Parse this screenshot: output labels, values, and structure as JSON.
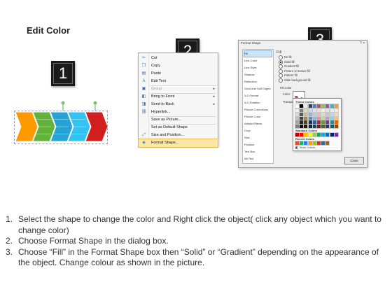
{
  "title": "Edit Color",
  "steps": {
    "one": "1",
    "two": "2",
    "three": "3"
  },
  "context_menu": {
    "items": [
      {
        "label": "Cut",
        "icon": "scissors-icon",
        "enabled": true,
        "submenu": false
      },
      {
        "label": "Copy",
        "icon": "copy-icon",
        "enabled": true,
        "submenu": false
      },
      {
        "label": "Paste",
        "icon": "paste-icon",
        "enabled": true,
        "submenu": false
      },
      {
        "label": "Edit Text",
        "icon": "edit-text-icon",
        "enabled": true,
        "submenu": false
      },
      {
        "label": "Group",
        "icon": "group-icon",
        "enabled": false,
        "submenu": true
      },
      {
        "label": "Bring to Front",
        "icon": "bring-front-icon",
        "enabled": true,
        "submenu": true
      },
      {
        "label": "Send to Back",
        "icon": "send-back-icon",
        "enabled": true,
        "submenu": true
      },
      {
        "label": "Hyperlink...",
        "icon": "hyperlink-icon",
        "enabled": true,
        "submenu": false
      },
      {
        "label": "Save as Picture...",
        "icon": "",
        "enabled": true,
        "submenu": false
      },
      {
        "label": "Set as Default Shape",
        "icon": "",
        "enabled": true,
        "submenu": false
      },
      {
        "label": "Size and Position...",
        "icon": "size-position-icon",
        "enabled": true,
        "submenu": false
      },
      {
        "label": "Format Shape...",
        "icon": "format-shape-icon",
        "enabled": true,
        "submenu": false,
        "highlighted": true
      }
    ]
  },
  "format_dialog": {
    "title": "Format Shape",
    "window_controls": "? ×",
    "categories": [
      "Fill",
      "Line Color",
      "Line Style",
      "Shadow",
      "Reflection",
      "Glow and Soft Edges",
      "3-D Format",
      "3-D Rotation",
      "Picture Corrections",
      "Picture Color",
      "Artistic Effects",
      "Crop",
      "Size",
      "Position",
      "Text Box",
      "Alt Text"
    ],
    "selected_category": "Fill",
    "heading": "Fill",
    "fill_options": [
      "No fill",
      "Solid fill",
      "Gradient fill",
      "Picture or texture fill",
      "Pattern fill",
      "Slide background fill"
    ],
    "selected_fill": "Solid fill",
    "fill_color_label": "Fill Color",
    "color_label": "Color:",
    "transparency_label": "Transpar",
    "close_label": "Close"
  },
  "palette": {
    "theme_label": "Theme Colors",
    "standard_label": "Standard Colors",
    "recent_label": "Recent Colors",
    "more_label": "More Colors...",
    "theme_top": [
      "#ffffff",
      "#000000",
      "#eeece1",
      "#1f497d",
      "#4f81bd",
      "#c0504d",
      "#9bbb59",
      "#8064a2",
      "#4bacc6",
      "#f79646"
    ],
    "theme_columns": [
      [
        "#f2f2f2",
        "#d9d9d9",
        "#bfbfbf",
        "#a6a6a6",
        "#808080"
      ],
      [
        "#7f7f7f",
        "#595959",
        "#404040",
        "#262626",
        "#0d0d0d"
      ],
      [
        "#ddd9c3",
        "#c4bd97",
        "#948a54",
        "#4a452a",
        "#1d1b10"
      ],
      [
        "#c6d9f1",
        "#8db3e2",
        "#548dd4",
        "#17365d",
        "#0f243e"
      ],
      [
        "#dbe5f1",
        "#b8cce4",
        "#95b3d7",
        "#366092",
        "#244061"
      ],
      [
        "#f2dcdb",
        "#e6b9b8",
        "#d99694",
        "#953734",
        "#632423"
      ],
      [
        "#ebf1dd",
        "#d7e3bc",
        "#c3d69b",
        "#76923c",
        "#4f6128"
      ],
      [
        "#e5e0ec",
        "#ccc1d9",
        "#b2a2c7",
        "#5f497a",
        "#3f3151"
      ],
      [
        "#dbeef3",
        "#b7dde8",
        "#92cddc",
        "#31859b",
        "#205867"
      ],
      [
        "#fdeada",
        "#fbd5b5",
        "#fac08f",
        "#e36c09",
        "#974806"
      ]
    ],
    "standard": [
      "#c00000",
      "#ff0000",
      "#ffc000",
      "#ffff00",
      "#92d050",
      "#00b050",
      "#00b0f0",
      "#0070c0",
      "#002060",
      "#7030a0"
    ],
    "recent": [
      "#e84c3d",
      "#27ae60",
      "#2a7fff",
      "#ff9900",
      "#99cc00",
      "#cc3333",
      "#336699",
      "#996633"
    ]
  },
  "shape_colors": [
    "#ff9900",
    "#63b33a",
    "#26a3d6",
    "#33c2f2",
    "#d11f1f"
  ],
  "instructions": [
    {
      "num": "1.",
      "text": "Select the shape to change the color and Right click the object( click any object which you want to change color)"
    },
    {
      "num": "2.",
      "text": "Choose Format Shape in the dialog box."
    },
    {
      "num": "3.",
      "text": "Choose “Fill” in the Format Shape box then “Solid” or “Gradient” depending on the appearance of the object. Change colour as shown in the picture."
    }
  ]
}
